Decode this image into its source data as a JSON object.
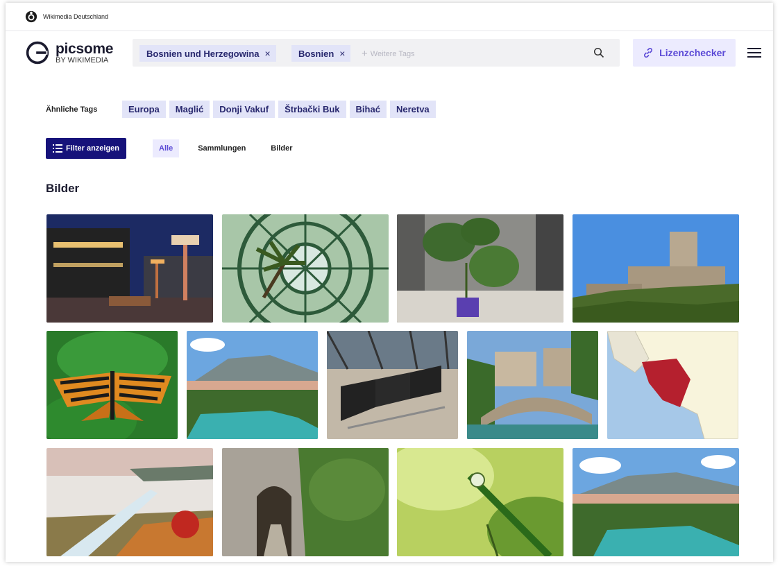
{
  "topbar": {
    "org_name": "Wikimedia Deutschland",
    "logo_icon": "wikimedia-logo-icon"
  },
  "brand": {
    "name": "picsome",
    "sub": "BY WIKIMEDIA"
  },
  "search": {
    "tags": [
      {
        "label": "Bosnien und Herzegowina",
        "remove_icon": "×"
      },
      {
        "label": "Bosnien",
        "remove_icon": "×"
      }
    ],
    "placeholder": "Weitere Tags",
    "search_icon": "search-icon"
  },
  "license_button": {
    "label": "Lizenzchecker",
    "icon": "link-icon"
  },
  "menu_icon": "hamburger-menu-icon",
  "similar_tags": {
    "label": "Ähnliche Tags",
    "tags": [
      "Europa",
      "Maglić",
      "Donji Vakuf",
      "Štrbački Buk",
      "Bihać",
      "Neretva"
    ]
  },
  "filters": {
    "button_label": "Filter anzeigen",
    "tabs": [
      "Alle",
      "Sammlungen",
      "Bilder"
    ],
    "active_tab": "Alle"
  },
  "section_title": "Bilder",
  "images": [
    {
      "subject": "modern building at night with lamps"
    },
    {
      "subject": "glass dome with palm tree"
    },
    {
      "subject": "monstera plant in pot"
    },
    {
      "subject": "medieval fortress on hill"
    },
    {
      "subject": "orange striped butterfly on leaf"
    },
    {
      "subject": "river town and mountains"
    },
    {
      "subject": "steel chairs in sunlight"
    },
    {
      "subject": "stone bridge in old town"
    },
    {
      "subject": "map of Bosnia and Herzegovina"
    },
    {
      "subject": "misty river valley in autumn"
    },
    {
      "subject": "stone archway with stairs"
    },
    {
      "subject": "dew drop on grass"
    },
    {
      "subject": "river town and mountains"
    }
  ],
  "colors": {
    "accent": "#5b4ad6",
    "primary_dark": "#16127a",
    "tag_bg": "#e2e4f8",
    "map_highlight": "#b5202e"
  }
}
